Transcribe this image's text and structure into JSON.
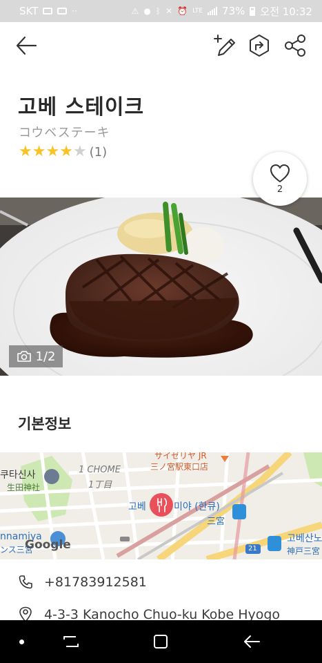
{
  "status_bar": {
    "carrier": "SKT",
    "battery": "73%",
    "time": "오전 10:32",
    "network": "LTE"
  },
  "toolbar": {
    "icons": [
      "back-arrow-icon",
      "edit-pen-icon",
      "directions-icon",
      "share-icon"
    ]
  },
  "place": {
    "name": "고베 스테이크",
    "name_local": "コウベステーキ",
    "rating_stars": 4,
    "rating_max": 5,
    "review_count": "(1)",
    "like_count": "2",
    "photo_counter": "1/2"
  },
  "section": {
    "basic_info_title": "기본정보"
  },
  "map": {
    "labels": {
      "shrine_kr": "쿠타신사",
      "shrine_jp": "生田神社",
      "chome_en": "1 CHOME",
      "chome_jp": "1丁目",
      "station_top": "サイゼリヤ JR",
      "station_top2": "三ノ宮駅東口店",
      "pin_label_a": "고베",
      "pin_label_b": "미야 (한큐)",
      "sannomiya": "三宮",
      "left_station_a": "nnamiya",
      "left_station_b": "ンス三宮",
      "google": "Google",
      "route": "21",
      "right_station_a": "고베산노",
      "right_station_b": "神戸三宮"
    }
  },
  "info": {
    "phone": "+81783912581",
    "address": "4-3-3 Kanocho Chuo-ku Kobe Hyogo"
  },
  "colors": {
    "star_filled": "#f7c325",
    "star_empty": "#d0d0d0",
    "pin": "#e8505b",
    "statusbar": "#d9d9d9"
  }
}
